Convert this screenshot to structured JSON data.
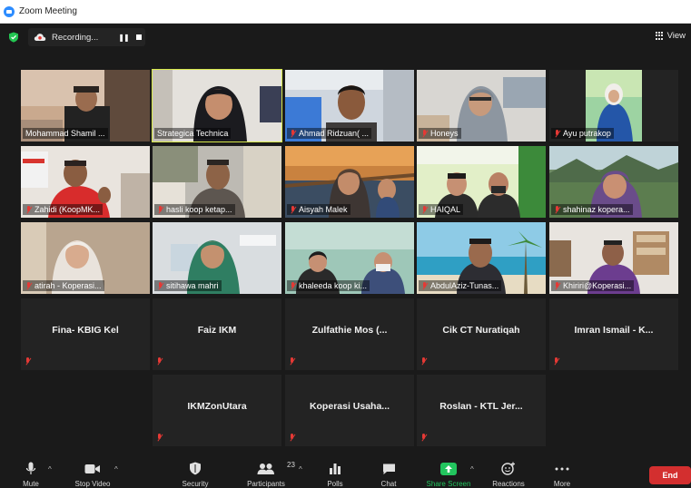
{
  "window": {
    "title": "Zoom Meeting"
  },
  "topbar": {
    "recording_label": "Recording...",
    "view_label": "View"
  },
  "participants": [
    {
      "name": "Mohammad Shamil ...",
      "muted": false,
      "active": false
    },
    {
      "name": "Strategica Technica",
      "muted": false,
      "active": true
    },
    {
      "name": "Ahmad Ridzuan( ...",
      "muted": true,
      "active": false
    },
    {
      "name": "Honeys",
      "muted": true,
      "active": false
    },
    {
      "name": "Ayu putrakop",
      "muted": true,
      "active": false
    },
    {
      "name": "Zahidi (KoopMK...",
      "muted": true,
      "active": false
    },
    {
      "name": "hasli koop ketap...",
      "muted": true,
      "active": false
    },
    {
      "name": "Aisyah Malek",
      "muted": true,
      "active": false
    },
    {
      "name": "HAIQAL",
      "muted": true,
      "active": false
    },
    {
      "name": "shahinaz kopera...",
      "muted": true,
      "active": false
    },
    {
      "name": "atirah - Koperasi...",
      "muted": true,
      "active": false
    },
    {
      "name": "sitihawa mahri",
      "muted": true,
      "active": false
    },
    {
      "name": "khaleeda koop ki...",
      "muted": true,
      "active": false
    },
    {
      "name": "AbdulAziz-Tunas...",
      "muted": true,
      "active": false
    },
    {
      "name": "Khiriri@Koperasi...",
      "muted": true,
      "active": false
    },
    {
      "name": "Fina- KBIG Kel",
      "muted": true,
      "video": false
    },
    {
      "name": "Faiz IKM",
      "muted": true,
      "video": false
    },
    {
      "name": "Zulfathie Mos (...",
      "muted": true,
      "video": false
    },
    {
      "name": "Cik CT Nuratiqah",
      "muted": true,
      "video": false
    },
    {
      "name": "Imran Ismail - K...",
      "muted": true,
      "video": false
    },
    {
      "name": "IKMZonUtara",
      "muted": true,
      "video": false
    },
    {
      "name": "Koperasi Usaha...",
      "muted": true,
      "video": false
    },
    {
      "name": "Roslan - KTL Jer...",
      "muted": true,
      "video": false
    }
  ],
  "toolbar": {
    "mute": "Mute",
    "stop_video": "Stop Video",
    "security": "Security",
    "participants": "Participants",
    "participants_count": "23",
    "polls": "Polls",
    "chat": "Chat",
    "share_screen": "Share Screen",
    "reactions": "Reactions",
    "more": "More",
    "end": "End"
  },
  "colors": {
    "active_speaker": "#d6e84a",
    "share_screen": "#22c55e",
    "end_button": "#d32f2f",
    "muted_icon": "#e53935"
  }
}
